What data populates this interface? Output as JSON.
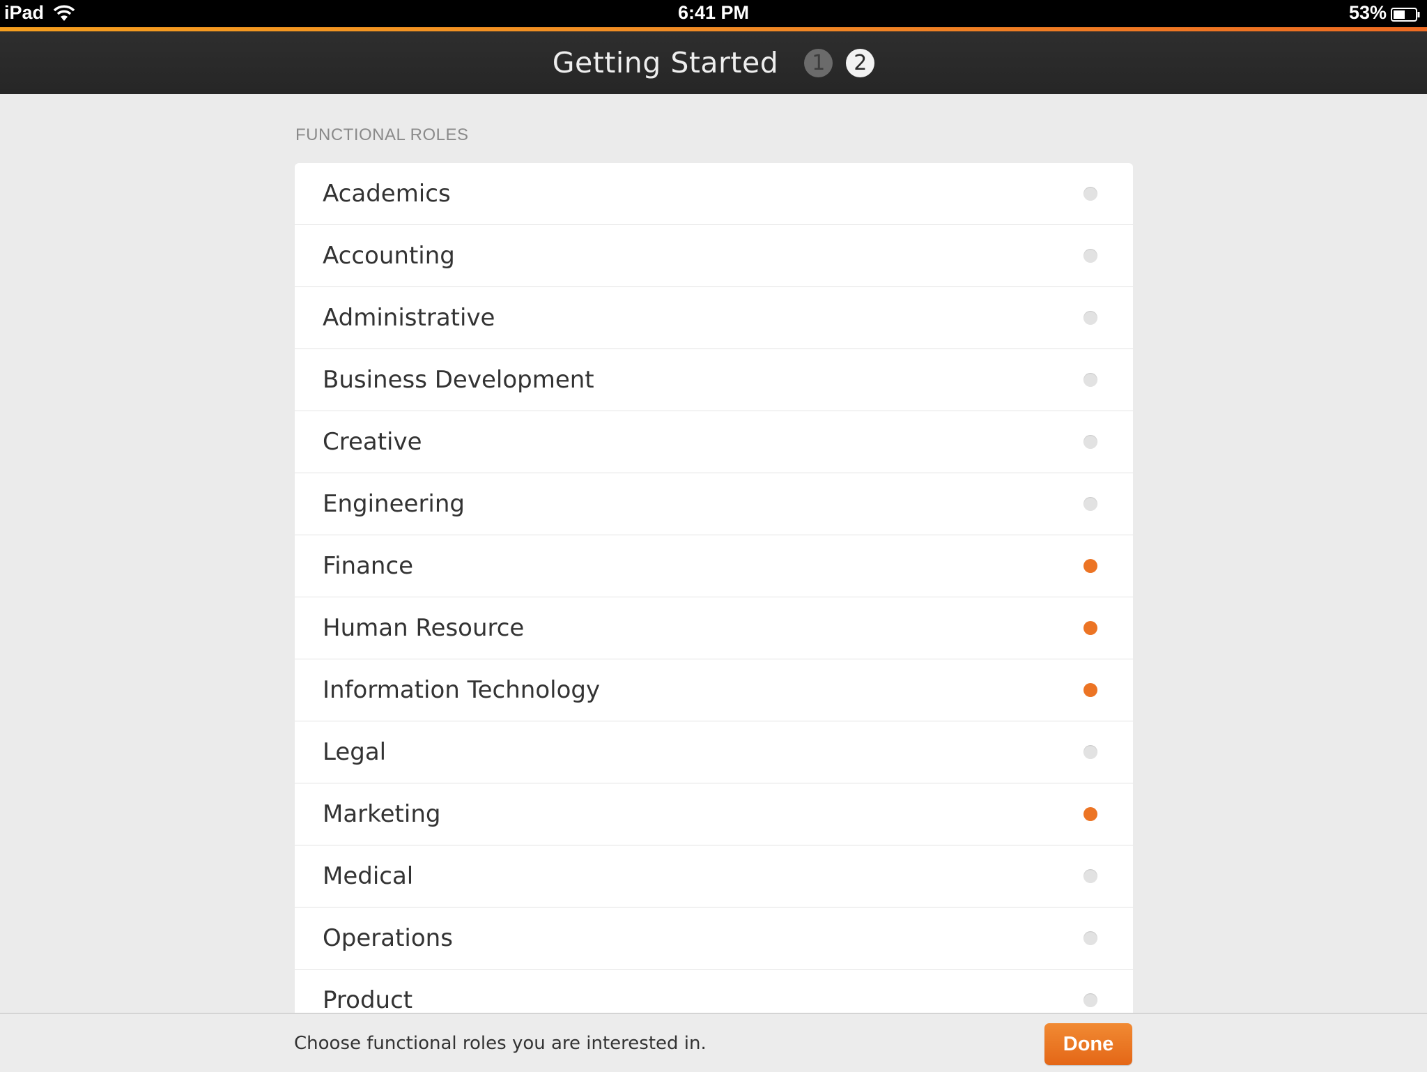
{
  "status_bar": {
    "device": "iPad",
    "time": "6:41 PM",
    "battery": "53%",
    "battery_level": 0.53
  },
  "header": {
    "title": "Getting Started",
    "steps": [
      "1",
      "2"
    ],
    "active_step": "2"
  },
  "section": {
    "label": "FUNCTIONAL ROLES"
  },
  "roles": [
    {
      "label": "Academics",
      "selected": false
    },
    {
      "label": "Accounting",
      "selected": false
    },
    {
      "label": "Administrative",
      "selected": false
    },
    {
      "label": "Business Development",
      "selected": false
    },
    {
      "label": "Creative",
      "selected": false
    },
    {
      "label": "Engineering",
      "selected": false
    },
    {
      "label": "Finance",
      "selected": true
    },
    {
      "label": "Human Resource",
      "selected": true
    },
    {
      "label": "Information Technology",
      "selected": true
    },
    {
      "label": "Legal",
      "selected": false
    },
    {
      "label": "Marketing",
      "selected": true
    },
    {
      "label": "Medical",
      "selected": false
    },
    {
      "label": "Operations",
      "selected": false
    },
    {
      "label": "Product",
      "selected": false
    }
  ],
  "footer": {
    "instruction": "Choose functional roles you are interested in.",
    "done_label": "Done"
  },
  "colors": {
    "accent": "#ec7424",
    "nav_background": "#2b2b2b",
    "unselected_dot": "#e2e2e2"
  }
}
